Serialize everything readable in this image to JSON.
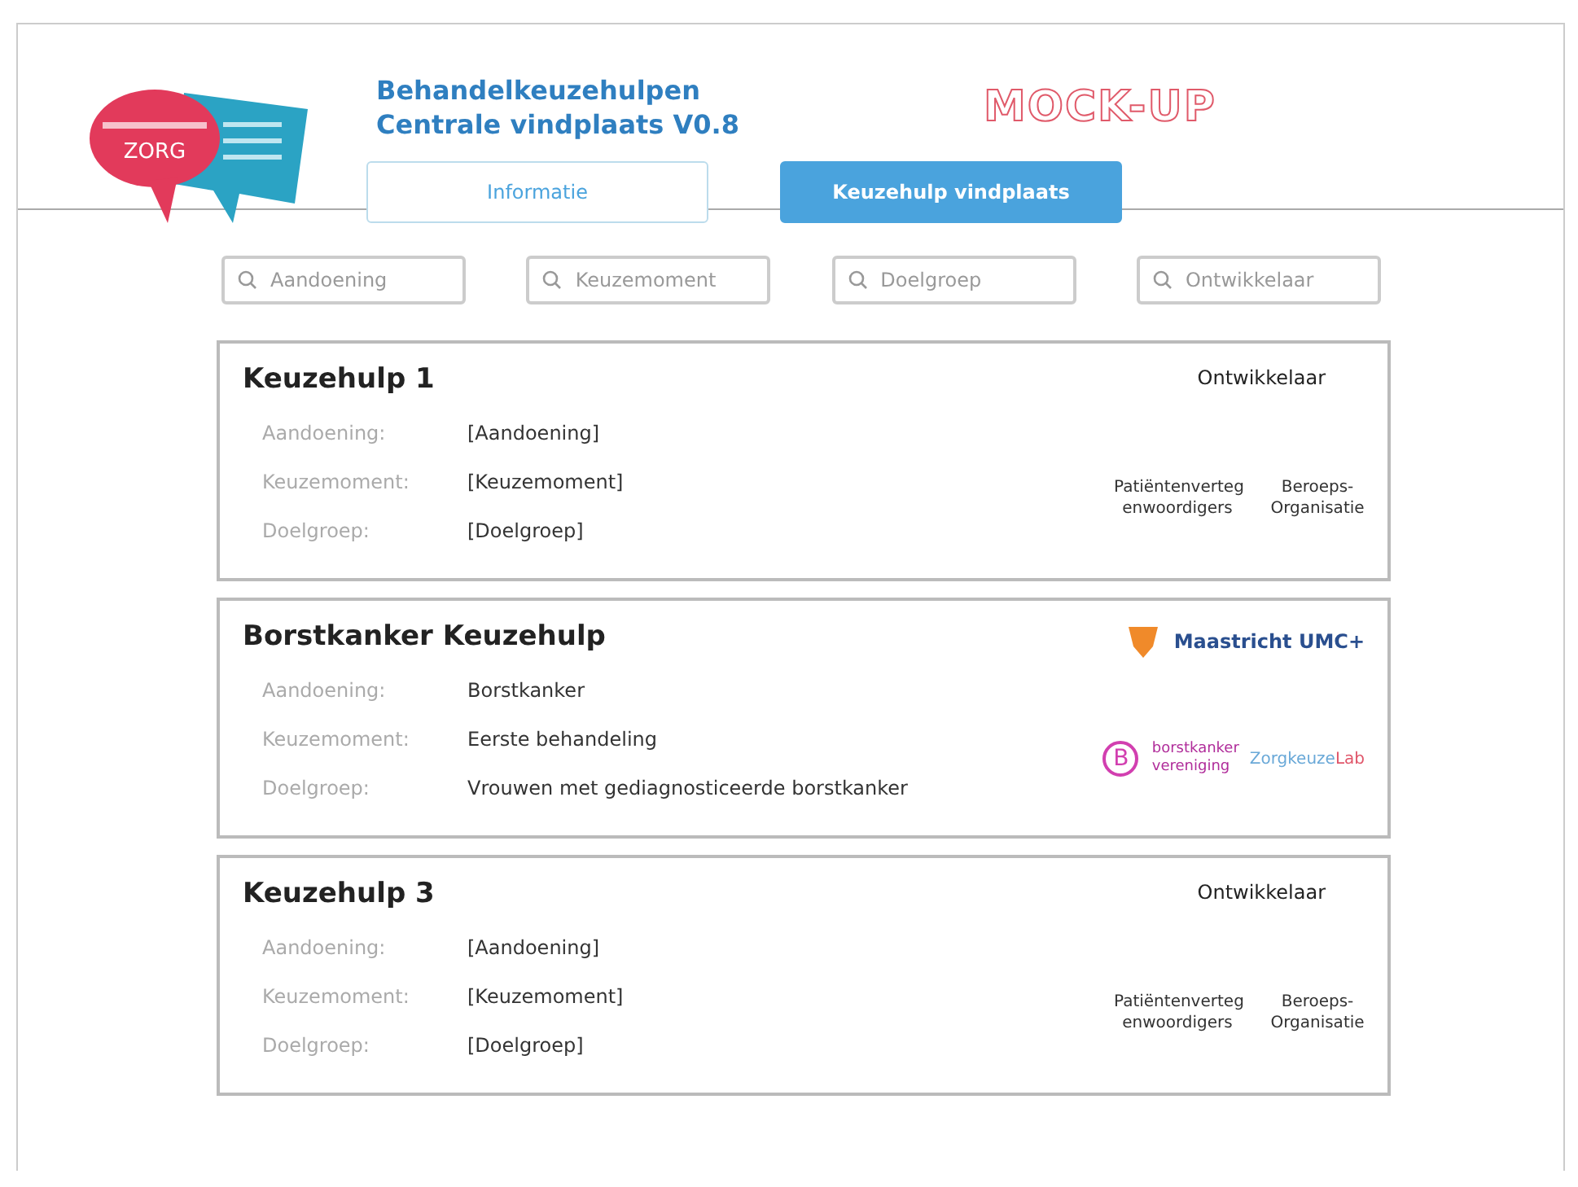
{
  "logo": {
    "text": "ZORG"
  },
  "header": {
    "title_lines": [
      "Behandelkeuzehulpen",
      "Centrale vindplaats V0.8"
    ],
    "stamp": "MOCK-UP"
  },
  "tabs": [
    {
      "label": "Informatie",
      "selected": false
    },
    {
      "label": "Keuzehulp vindplaats",
      "selected": true
    }
  ],
  "filters": [
    {
      "placeholder": "Aandoening"
    },
    {
      "placeholder": "Keuzemoment"
    },
    {
      "placeholder": "Doelgroep"
    },
    {
      "placeholder": "Ontwikkelaar"
    }
  ],
  "cards": [
    {
      "kind": "placeholder",
      "title": "Keuzehulp 1",
      "fields": [
        {
          "label": "Aandoening:",
          "value": "[Aandoening]"
        },
        {
          "label": "Keuzemoment:",
          "value": "[Keuzemoment]"
        },
        {
          "label": "Doelgroep:",
          "value": "[Doelgroep]"
        }
      ],
      "developer": {
        "heading": "Ontwikkelaar",
        "parties": [
          "Patiëntenverteg enwoordigers",
          "Beroeps-Organisatie"
        ]
      }
    },
    {
      "kind": "logos",
      "title": "Borstkanker Keuzehulp",
      "fields": [
        {
          "label": "Aandoening:",
          "value": "Borstkanker"
        },
        {
          "label": "Keuzemoment:",
          "value": "Eerste behandeling"
        },
        {
          "label": "Doelgroep:",
          "value": "Vrouwen met gediagnosticeerde borstkanker"
        }
      ],
      "developer": {
        "main_logo": "Maastricht UMC+",
        "partner_logo": "borstkanker vereniging",
        "partner_mark": "B",
        "lab_logo": [
          "Zorgkeuze",
          "Lab"
        ]
      }
    },
    {
      "kind": "placeholder",
      "title": "Keuzehulp 3",
      "fields": [
        {
          "label": "Aandoening:",
          "value": "[Aandoening]"
        },
        {
          "label": "Keuzemoment:",
          "value": "[Keuzemoment]"
        },
        {
          "label": "Doelgroep:",
          "value": "[Doelgroep]"
        }
      ],
      "developer": {
        "heading": "Ontwikkelaar",
        "parties": [
          "Patiëntenverteg enwoordigers",
          "Beroeps-Organisatie"
        ]
      }
    }
  ]
}
